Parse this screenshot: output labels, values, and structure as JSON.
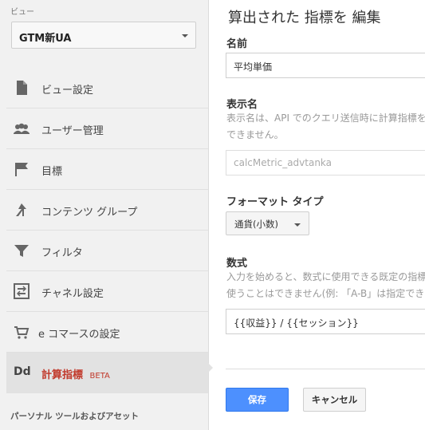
{
  "sidebar": {
    "view_label": "ビュー",
    "view_selected": "GTM新UA",
    "items": [
      {
        "label": "ビュー設定",
        "icon": "document-icon"
      },
      {
        "label": "ユーザー管理",
        "icon": "users-icon"
      },
      {
        "label": "目標",
        "icon": "flag-icon"
      },
      {
        "label": "コンテンツ グループ",
        "icon": "content-group-icon"
      },
      {
        "label": "フィルタ",
        "icon": "filter-icon"
      },
      {
        "label": "チャネル設定",
        "icon": "channel-settings-icon"
      },
      {
        "label": "e コマースの設定",
        "icon": "cart-icon"
      },
      {
        "label": "計算指標",
        "icon": "dd-icon",
        "badge": "BETA",
        "active": true
      }
    ],
    "dd_icon_text": "Dd",
    "personal_heading": "パーソナル ツールおよびアセット"
  },
  "main": {
    "title": "算出された 指標を 編集",
    "name_label": "名前",
    "name_value": "平均単価",
    "display_label": "表示名",
    "display_help_1": "表示名は、API でのクエリ送信時に計算指標を参照",
    "display_help_2": "できません。",
    "display_value": "calcMetric_advtanka",
    "format_label": "フォーマット タイプ",
    "format_value": "通貨(小数)",
    "formula_label": "数式",
    "formula_help_1": "入力を始めると、数式に使用できる既定の指標が表示",
    "formula_help_2": "使うことはできません(例: 「A-B」は指定できません",
    "formula_value": "{{収益}} / {{セッション}}",
    "save_label": "保存",
    "cancel_label": "キャンセル"
  },
  "colors": {
    "accent_red": "#c1392b",
    "primary_blue": "#4d90fe"
  }
}
